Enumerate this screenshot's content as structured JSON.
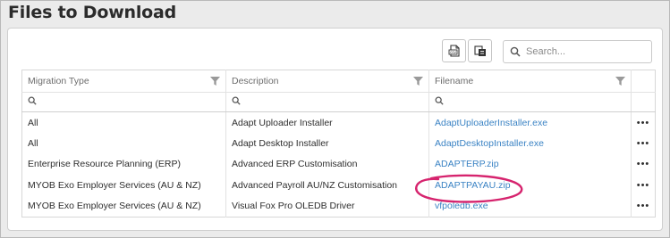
{
  "page": {
    "title": "Files to Download"
  },
  "toolbar": {
    "export_icon": "export-csv-icon",
    "columns_icon": "column-chooser-icon",
    "search_placeholder": "Search..."
  },
  "table": {
    "columns": [
      "Migration Type",
      "Description",
      "Filename"
    ],
    "rows": [
      {
        "migration_type": "All",
        "description": "Adapt Uploader Installer",
        "filename": "AdaptUploaderInstaller.exe",
        "actions": "•••"
      },
      {
        "migration_type": "All",
        "description": "Adapt Desktop Installer",
        "filename": "AdaptDesktopInstaller.exe",
        "actions": "•••"
      },
      {
        "migration_type": "Enterprise Resource Planning (ERP)",
        "description": "Advanced ERP Customisation",
        "filename": "ADAPTERP.zip",
        "actions": "•••"
      },
      {
        "migration_type": "MYOB Exo Employer Services (AU & NZ)",
        "description": "Advanced Payroll AU/NZ Customisation",
        "filename": "ADAPTPAYAU.zip",
        "actions": "•••"
      },
      {
        "migration_type": "MYOB Exo Employer Services (AU & NZ)",
        "description": "Visual Fox Pro OLEDB Driver",
        "filename": "vfpoledb.exe",
        "actions": "•••"
      }
    ]
  },
  "colors": {
    "link": "#3b83c4",
    "highlight_ellipse": "#d6246e",
    "background": "#ebebeb"
  }
}
